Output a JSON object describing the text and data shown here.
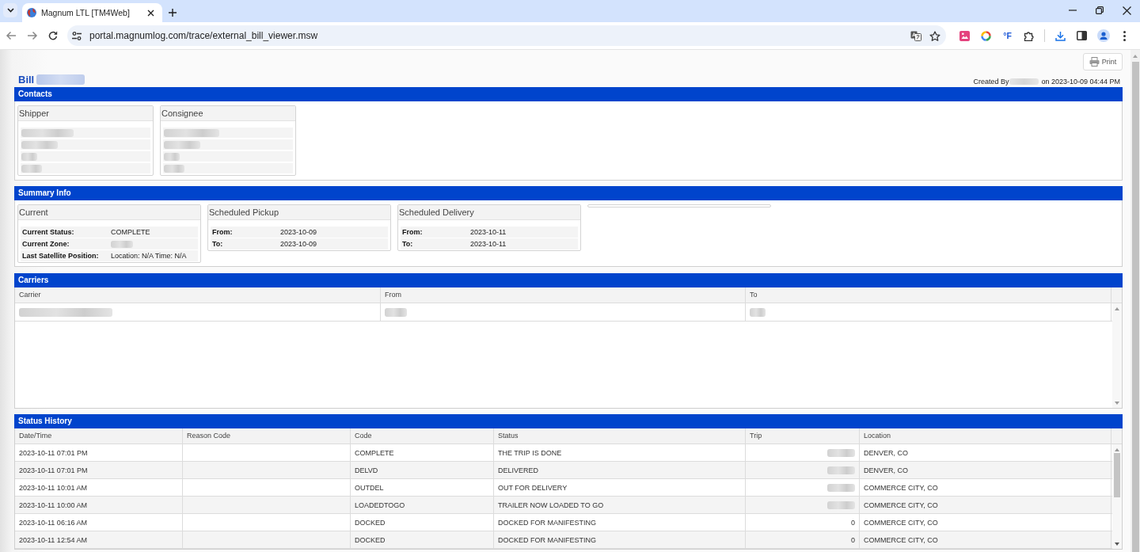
{
  "browser": {
    "tab_title": "Magnum LTL [TM4Web]",
    "url": "portal.magnumlog.com/trace/external_bill_viewer.msw",
    "extension_label": "°F"
  },
  "page": {
    "print_label": "Print",
    "bill_label": "Bill",
    "bill_number_redacted": true,
    "created_by_label": "Created By",
    "creator_redacted": true,
    "created_on": "on 2023-10-09 04:44 PM"
  },
  "contacts": {
    "title": "Contacts",
    "cards": [
      {
        "title": "Shipper",
        "lines": [
          {
            "redacted": true
          },
          {
            "redacted": true
          },
          {
            "redacted": true
          },
          {
            "redacted": true
          }
        ]
      },
      {
        "title": "Consignee",
        "lines": [
          {
            "redacted": true
          },
          {
            "redacted": true
          },
          {
            "redacted": true
          },
          {
            "redacted": true
          }
        ]
      }
    ]
  },
  "summary_info": {
    "title": "Summary Info",
    "cards": [
      {
        "title": "Current",
        "fields": [
          {
            "label": "Current Status:",
            "value": "COMPLETE",
            "redacted": false
          },
          {
            "label": "Current Zone:",
            "redacted": true
          },
          {
            "label": "Last Satellite Position:",
            "value": "Location: N/A Time: N/A",
            "redacted": false
          }
        ]
      },
      {
        "title": "Scheduled Pickup",
        "fields": [
          {
            "label": "From:",
            "value": "2023-10-09",
            "redacted": false
          },
          {
            "label": "To:",
            "value": "2023-10-09",
            "redacted": false
          }
        ]
      },
      {
        "title": "Scheduled Delivery",
        "fields": [
          {
            "label": "From:",
            "value": "2023-10-11",
            "redacted": false
          },
          {
            "label": "To:",
            "value": "2023-10-11",
            "redacted": false
          }
        ]
      }
    ]
  },
  "carriers": {
    "title": "Carriers",
    "columns": [
      "Carrier",
      "From",
      "To"
    ],
    "rows": [
      {
        "cells": [
          {
            "redacted": true
          },
          {
            "redacted": true
          },
          {
            "redacted": true
          }
        ]
      }
    ]
  },
  "status_history": {
    "title": "Status History",
    "columns": [
      "Date/Time",
      "Reason Code",
      "Code",
      "Status",
      "Trip",
      "Location"
    ],
    "rows": [
      {
        "date_time": "2023-10-11 07:01 PM",
        "code": "COMPLETE",
        "status": "THE TRIP IS DONE",
        "trip_redacted": true,
        "location": "DENVER, CO"
      },
      {
        "date_time": "2023-10-11 07:01 PM",
        "code": "DELVD",
        "status": "DELIVERED",
        "trip_redacted": true,
        "location": "DENVER, CO"
      },
      {
        "date_time": "2023-10-11 10:01 AM",
        "code": "OUTDEL",
        "status": "OUT FOR DELIVERY",
        "trip_redacted": true,
        "location": "COMMERCE CITY, CO"
      },
      {
        "date_time": "2023-10-11 10:00 AM",
        "code": "LOADEDTOGO",
        "status": "TRAILER NOW LOADED TO GO",
        "trip_redacted": true,
        "location": "COMMERCE CITY, CO"
      },
      {
        "date_time": "2023-10-11 06:16 AM",
        "code": "DOCKED",
        "status": "DOCKED FOR MANIFESTING",
        "trip": "0",
        "trip_redacted": false,
        "location": "COMMERCE CITY, CO"
      },
      {
        "date_time": "2023-10-11 12:54 AM",
        "code": "DOCKED",
        "status": "DOCKED FOR MANIFESTING",
        "trip": "0",
        "trip_redacted": false,
        "location": "COMMERCE CITY, CO"
      }
    ]
  }
}
